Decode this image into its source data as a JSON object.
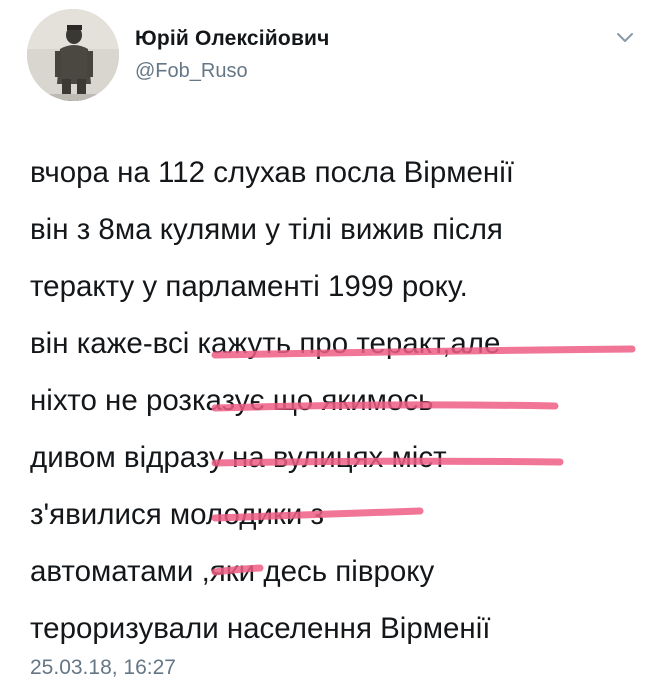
{
  "tweet": {
    "author": {
      "display_name": "Юрій Олексійович",
      "handle": "@Fob_Ruso"
    },
    "menu_icon": "chevron-down-icon",
    "lines": [
      "вчора на 112 слухав посла Вірменії",
      "він з 8ма кулями у тілі вижив  після",
      "теракту у парламенті 1999 року.",
      "він каже-всі кажуть про теракт,але",
      "ніхто не розказує що якимось",
      "дивом відразу на вулицях міст",
      "з'явилися молодики з",
      "автоматами ,яки десь півроку",
      "тероризували населення Вірменії"
    ],
    "timestamp": "25.03.18, 16:27"
  },
  "colors": {
    "text": "#14171a",
    "secondary": "#657786",
    "highlight": "#ef5d85"
  }
}
